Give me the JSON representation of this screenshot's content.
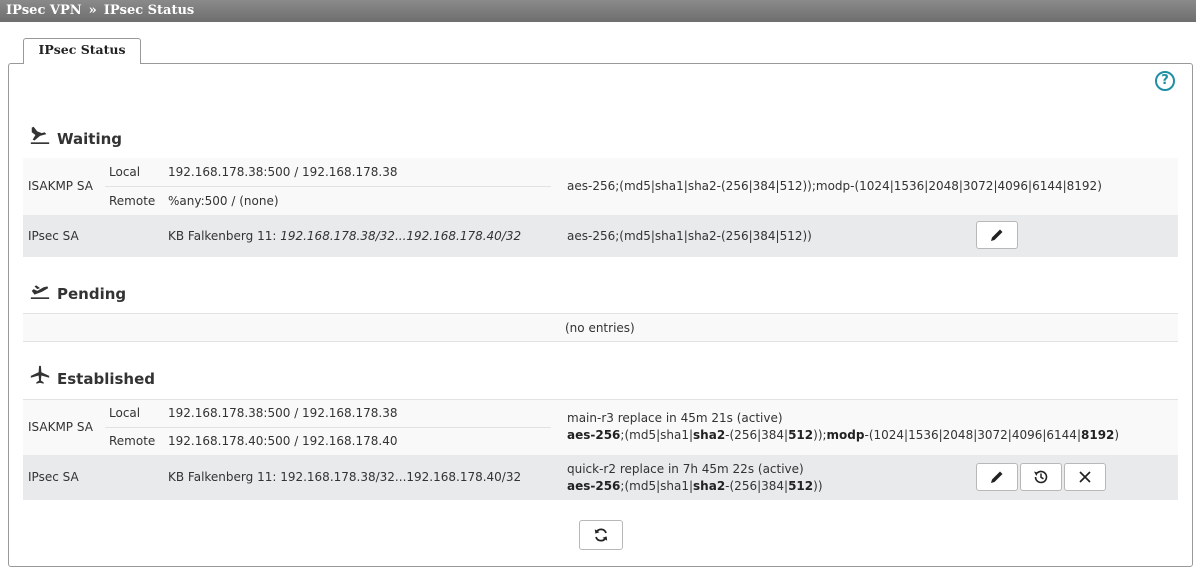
{
  "breadcrumb": {
    "parent": "IPsec VPN",
    "separator": "»",
    "current": "IPsec Status"
  },
  "tab": {
    "label": "IPsec Status"
  },
  "help": {
    "icon": "help-circle-icon",
    "glyph": "?"
  },
  "sections": {
    "waiting": {
      "title": "Waiting",
      "icon": "plane-landing-icon",
      "isakmp": {
        "label": "ISAKMP SA",
        "local_label": "Local",
        "local_value": "192.168.178.38:500 / 192.168.178.38",
        "remote_label": "Remote",
        "remote_value": "%any:500 / (none)",
        "proposal": "aes-256;(md5|sha1|sha2-(256|384|512));modp-(1024|1536|2048|3072|4096|6144|8192)"
      },
      "ipsec": {
        "label": "IPsec SA",
        "conn_name": "KB Falkenberg 11: ",
        "conn_nets": "192.168.178.38/32...192.168.178.40/32",
        "proposal": "aes-256;(md5|sha1|sha2-(256|384|512))"
      }
    },
    "pending": {
      "title": "Pending",
      "icon": "plane-takeoff-icon",
      "empty": "(no entries)"
    },
    "established": {
      "title": "Established",
      "icon": "plane-icon",
      "isakmp": {
        "label": "ISAKMP SA",
        "local_label": "Local",
        "local_value": "192.168.178.38:500 / 192.168.178.38",
        "remote_label": "Remote",
        "remote_value": "192.168.178.40:500 / 192.168.178.40",
        "status": "main-r3 replace in 45m 21s (active)",
        "p_aes": "aes-256",
        "p_a": ";(md5|sha1|",
        "p_sha2": "sha2",
        "p_b": "-(256|384|",
        "p_512": "512",
        "p_c": "));",
        "p_modp": "modp",
        "p_d": "-(1024|1536|2048|3072|4096|6144|",
        "p_8192": "8192",
        "p_e": ")"
      },
      "ipsec": {
        "label": "IPsec SA",
        "conn": "KB Falkenberg 11: 192.168.178.38/32...192.168.178.40/32",
        "status": "quick-r2 replace in 7h 45m 22s (active)",
        "p_aes": "aes-256",
        "p_a": ";(md5|sha1|",
        "p_sha2": "sha2",
        "p_b": "-(256|384|",
        "p_512": "512",
        "p_c": "))"
      }
    }
  },
  "buttons": {
    "edit_icon": "pencil-icon",
    "history_icon": "history-icon",
    "close_icon": "close-icon",
    "refresh_icon": "refresh-icon"
  },
  "colors": {
    "titlebar": "#7a7a7a",
    "accent": "#1f8fa6",
    "row_alt": "#e8eaec"
  }
}
